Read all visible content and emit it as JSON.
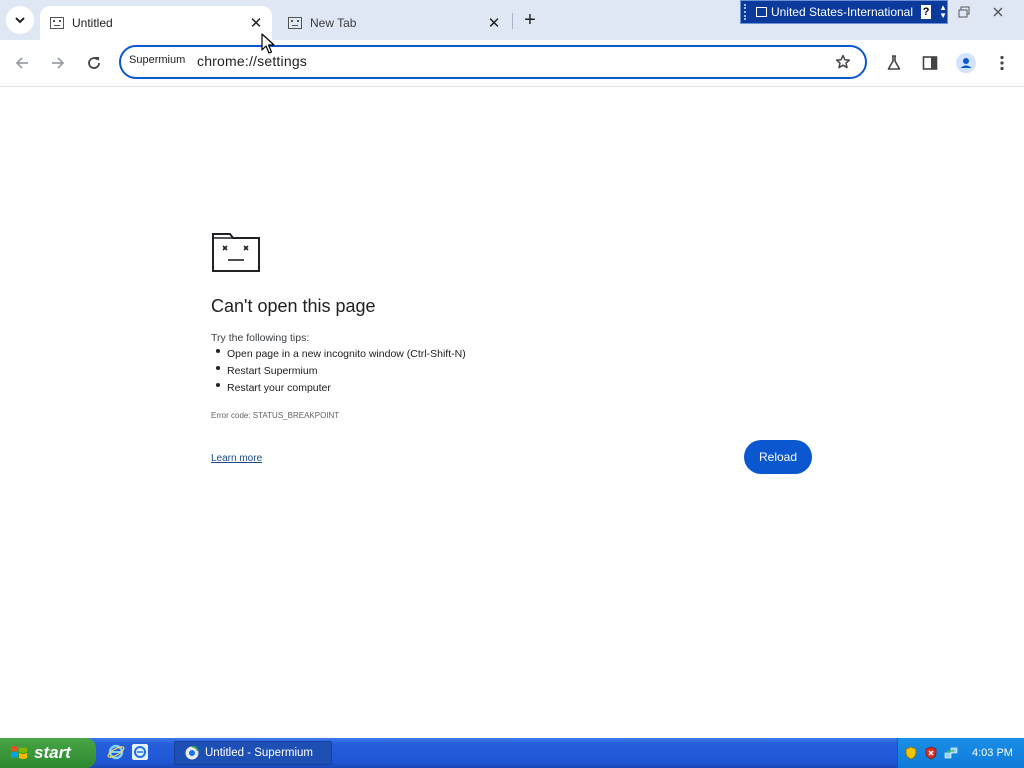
{
  "browser": {
    "tabs": [
      {
        "title": "Untitled",
        "active": true
      },
      {
        "title": "New Tab",
        "active": false
      }
    ],
    "omnibox": {
      "chip": "Supermium",
      "url": "chrome://settings"
    }
  },
  "language_bar": {
    "language": "United States-International",
    "help": "?"
  },
  "error_page": {
    "title": "Can't open this page",
    "tips_label": "Try the following tips:",
    "tips": [
      "Open page in a new incognito window (Ctrl-Shift-N)",
      "Restart Supermium",
      "Restart your computer"
    ],
    "error_code": "Error code: STATUS_BREAKPOINT",
    "learn_more": "Learn more",
    "reload": "Reload"
  },
  "taskbar": {
    "start_label": "start",
    "task_item": "Untitled - Supermium",
    "clock": "4:03 PM"
  },
  "colors": {
    "accent": "#0b57d0",
    "tabstrip": "#dfe7f5",
    "taskbar": "#245edb",
    "start": "#3c9a3c"
  }
}
